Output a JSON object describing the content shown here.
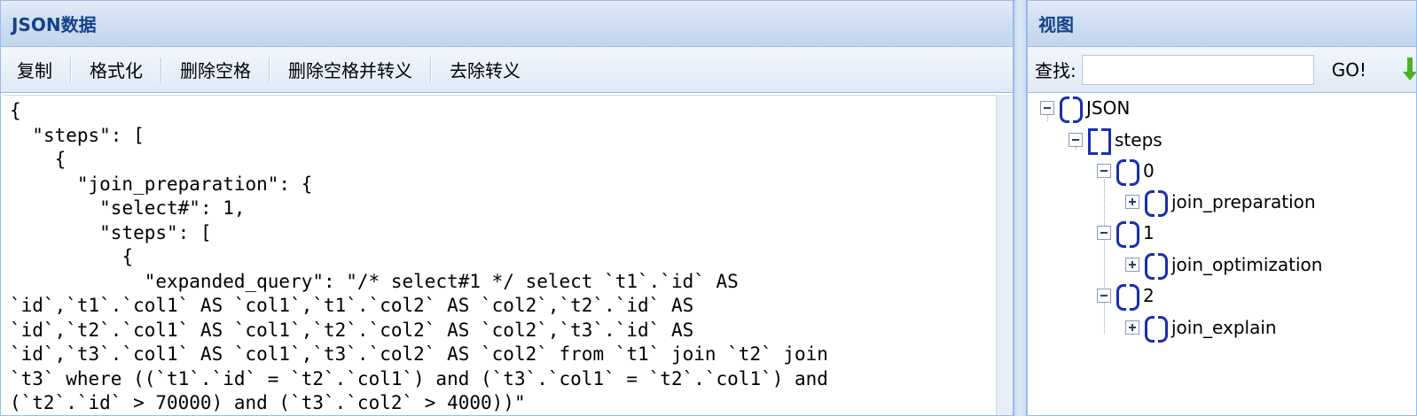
{
  "left": {
    "title": "JSON数据",
    "toolbar": {
      "copy": "复制",
      "format": "格式化",
      "remove_spaces": "删除空格",
      "remove_spaces_escape": "删除空格并转义",
      "unescape": "去除转义"
    },
    "editor_text": "{\n  \"steps\": [\n    {\n      \"join_preparation\": {\n        \"select#\": 1,\n        \"steps\": [\n          {\n            \"expanded_query\": \"/* select#1 */ select `t1`.`id` AS\n`id`,`t1`.`col1` AS `col1`,`t1`.`col2` AS `col2`,`t2`.`id` AS\n`id`,`t2`.`col1` AS `col1`,`t2`.`col2` AS `col2`,`t3`.`id` AS\n`id`,`t3`.`col1` AS `col1`,`t3`.`col2` AS `col2` from `t1` join `t2` join\n`t3` where ((`t1`.`id` = `t2`.`col1`) and (`t3`.`col1` = `t2`.`col1`) and\n(`t2`.`id` > 70000) and (`t3`.`col2` > 4000))\""
  },
  "right": {
    "title": "视图",
    "search_label": "查找:",
    "search_value": "",
    "go_label": "GO!",
    "tree": [
      {
        "label": "JSON",
        "icon": "curly-braces-icon",
        "toggle": "minus"
      },
      {
        "label": "steps",
        "icon": "square-brackets-icon",
        "toggle": "minus"
      },
      {
        "label": "0",
        "icon": "curly-braces-icon",
        "toggle": "minus"
      },
      {
        "label": "join_preparation",
        "icon": "curly-braces-icon",
        "toggle": "plus"
      },
      {
        "label": "1",
        "icon": "curly-braces-icon",
        "toggle": "minus"
      },
      {
        "label": "join_optimization",
        "icon": "curly-braces-icon",
        "toggle": "plus"
      },
      {
        "label": "2",
        "icon": "curly-braces-icon",
        "toggle": "minus"
      },
      {
        "label": "join_explain",
        "icon": "curly-braces-icon",
        "toggle": "plus"
      }
    ]
  }
}
